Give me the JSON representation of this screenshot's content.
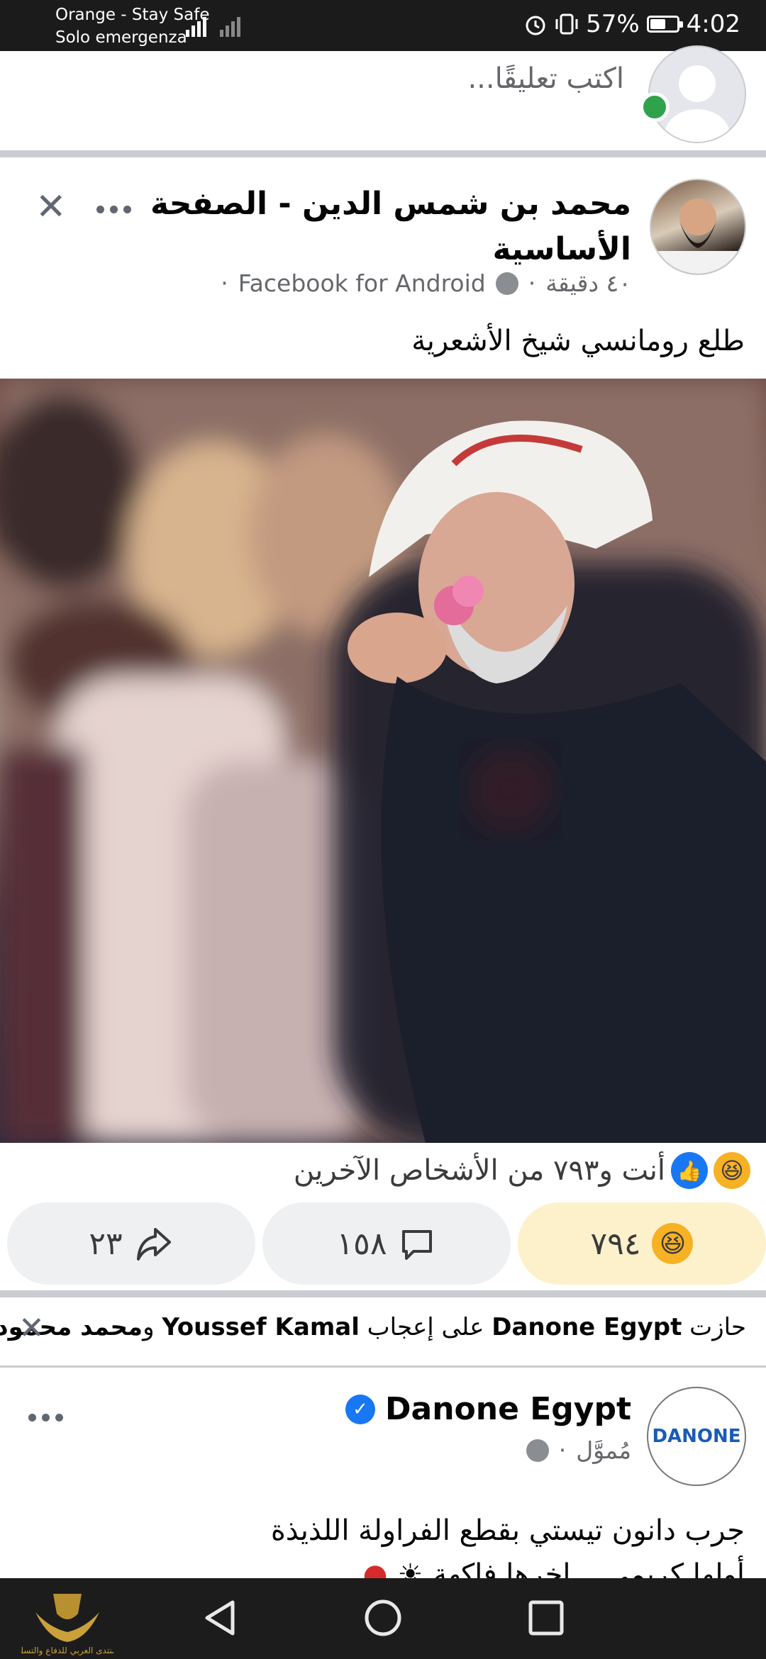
{
  "status_bar": {
    "carrier_line1": "Orange - Stay Safe",
    "carrier_line2": "Solo emergenza",
    "battery_percent": "57%",
    "battery_level": 0.57,
    "time": "4:02"
  },
  "composer": {
    "placeholder": "اكتب تعليقًا..."
  },
  "post": {
    "author": "محمد بن شمس الدين - الصفحة الأساسية",
    "time": "٤٠ دقيقة",
    "source": "Facebook for Android",
    "text": "طلع رومانسي شيخ الأشعرية",
    "reactions_summary": "أنت و٧٩٣ من الأشخاص الآخرين",
    "reaction_count": "٧٩٤",
    "comment_count": "١٥٨",
    "share_count": "٢٣"
  },
  "notification": {
    "prefix": "حازت ",
    "page": "Danone Egypt",
    "middle": " على إعجاب ",
    "friend1": "Youssef Kamal",
    "and": " و",
    "friend2": "محمد محمود",
    "suffix": "."
  },
  "ad": {
    "page_name": "Danone Egypt",
    "sponsored": "مُموَّل",
    "logo_text": "DANONE",
    "line1": "جرب دانون تيستي بقطع الفراولة اللذيذة",
    "line2": "أولها كريمي... اخرها فاكهة"
  },
  "colors": {
    "accent": "#1877f2",
    "online": "#31a24c",
    "haha": "#f7b125"
  },
  "icons": [
    "signal-icon",
    "alarm-icon",
    "vibrate-icon",
    "battery-icon",
    "globe-icon",
    "more-icon",
    "close-icon",
    "share-icon",
    "comment-icon",
    "haha-icon",
    "like-icon",
    "verified-icon",
    "back-icon",
    "home-icon",
    "recents-icon"
  ],
  "watermark": "المنتدى العربي للدفاع والتسليح"
}
